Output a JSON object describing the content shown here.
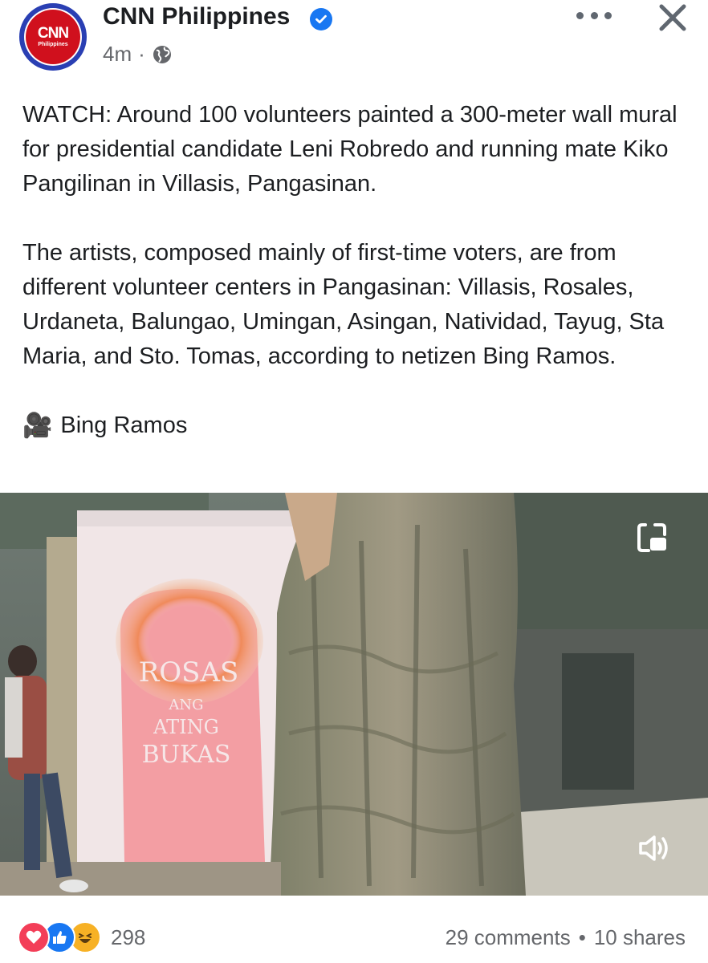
{
  "post": {
    "page_name": "CNN Philippines",
    "avatar_logo": "CNN",
    "avatar_sub": "Philippines",
    "time": "4m",
    "separator": "·",
    "privacy_icon": "globe-icon",
    "paragraph1": "WATCH: Around 100 volunteers painted a 300-meter wall mural for presidential candidate Leni Robredo and running mate Kiko Pangilinan in Villasis, Pangasinan.",
    "paragraph2": "The artists, composed mainly of first-time voters, are from different volunteer centers in Pangasinan: Villasis, Rosales, Urdaneta, Balungao, Umingan, Asingan, Natividad, Tayug, Sta Maria, and Sto. Tomas, according to netizen Bing Ramos.",
    "credit_icon": "🎥",
    "credit_name": "Bing Ramos"
  },
  "video": {
    "mural_line1": "ROSAS",
    "mural_line2": "ANG",
    "mural_line3": "ATING",
    "mural_line4": "BUKAS"
  },
  "footer": {
    "reaction_count": "298",
    "comments": "29 comments",
    "separator": "•",
    "shares": "10 shares"
  },
  "colors": {
    "brand_blue": "#1877f2",
    "cnn_red": "#d0101d",
    "muted_text": "#65676b"
  }
}
